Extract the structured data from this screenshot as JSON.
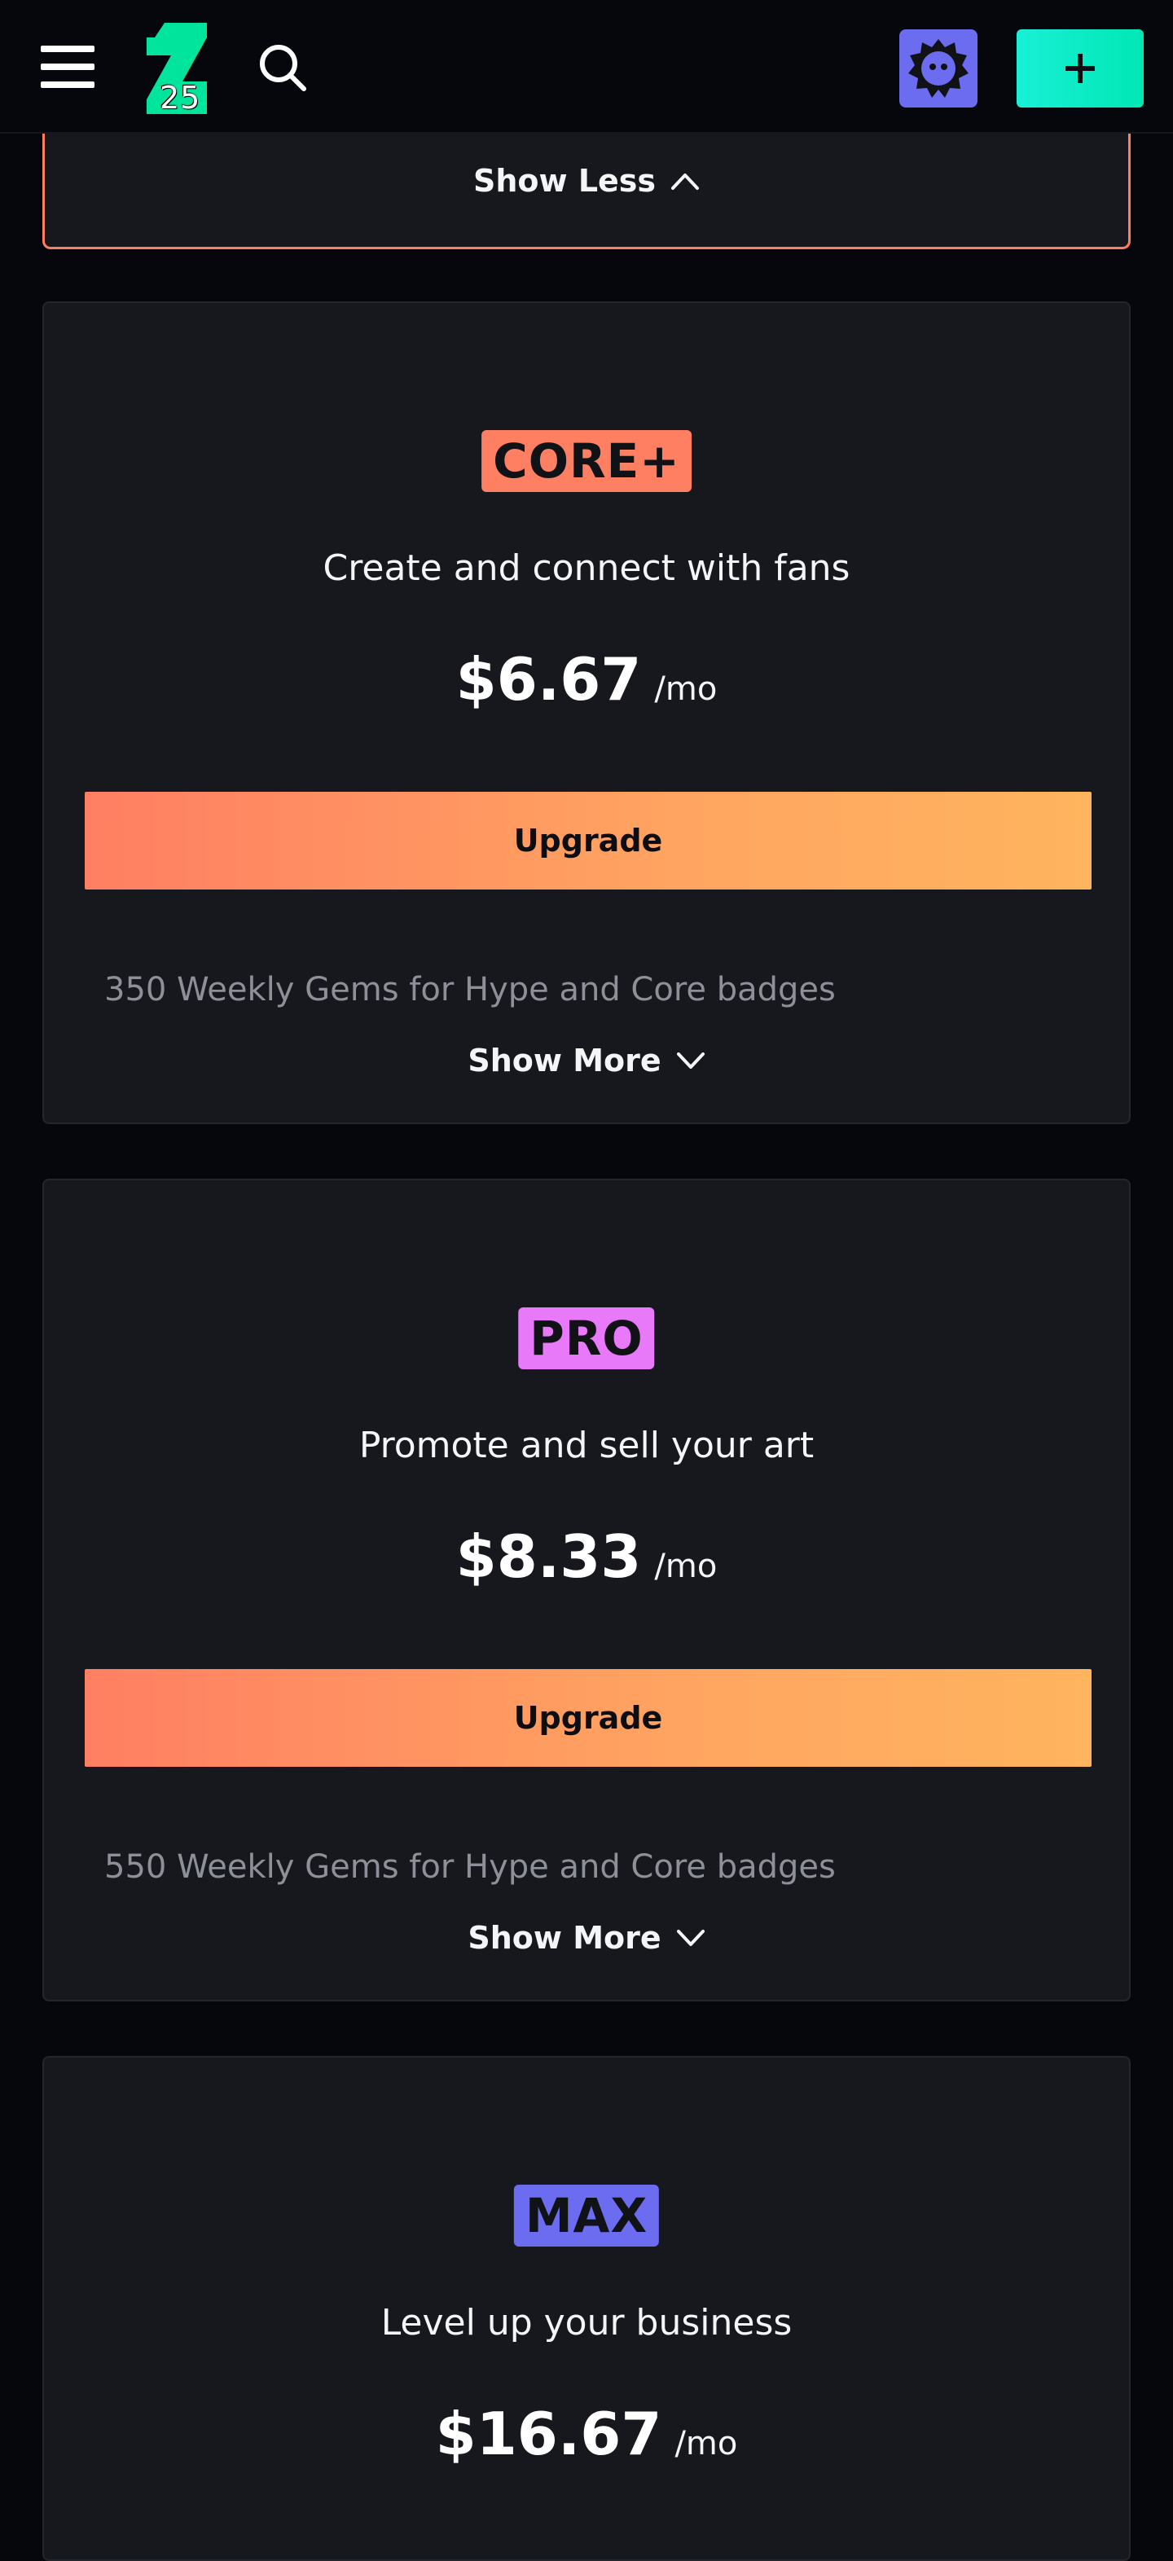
{
  "header": {
    "logo_text": "25",
    "brand_color": "#00e59b",
    "avatar_color": "#6b6cf0",
    "create_color": "#19f0d6",
    "icons": [
      "menu-icon",
      "search-icon",
      "avatar-icon",
      "plus-icon"
    ]
  },
  "previous_card": {
    "toggle_label": "Show Less",
    "border_color": "#ff7e5f"
  },
  "plans": [
    {
      "badge": "CORE+",
      "badge_color": "#ff7f62",
      "tagline": "Create and connect with fans",
      "price": "$6.67",
      "period": "/mo",
      "button": "Upgrade",
      "feature": "350 Weekly Gems for Hype and Core badges",
      "toggle_label": "Show More"
    },
    {
      "badge": "PRO",
      "badge_color": "#e879f9",
      "tagline": "Promote and sell your art",
      "price": "$8.33",
      "period": "/mo",
      "button": "Upgrade",
      "feature": "550 Weekly Gems for Hype and Core badges",
      "toggle_label": "Show More"
    },
    {
      "badge": "MAX",
      "badge_color": "#6b6cf0",
      "tagline": "Level up your business",
      "price": "$16.67",
      "period": "/mo"
    }
  ]
}
